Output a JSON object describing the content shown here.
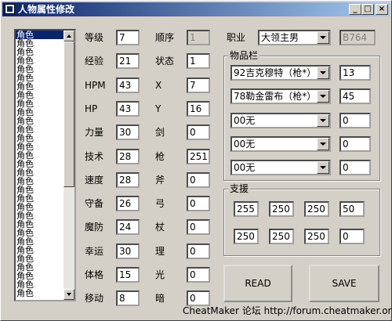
{
  "window": {
    "title": "人物属性修改",
    "minimize": "_",
    "maximize": "□",
    "close": "×"
  },
  "list": {
    "selected_index": 0,
    "items": [
      "角色",
      "角色",
      "角色",
      "角色",
      "角色",
      "角色",
      "角色",
      "角色",
      "角色",
      "角色",
      "角色",
      "角色",
      "角色",
      "角色",
      "角色",
      "角色",
      "角色",
      "角色",
      "角色",
      "角色",
      "角色",
      "角色",
      "角色",
      "角色",
      "角色",
      "角色",
      "角色",
      "角色",
      "角色",
      "角色",
      "角色"
    ]
  },
  "stats_left": [
    {
      "label": "等级",
      "value": "7"
    },
    {
      "label": "经验",
      "value": "21"
    },
    {
      "label": "HPM",
      "value": "43"
    },
    {
      "label": "HP",
      "value": "43"
    },
    {
      "label": "力量",
      "value": "30"
    },
    {
      "label": "技术",
      "value": "28"
    },
    {
      "label": "速度",
      "value": "28"
    },
    {
      "label": "守备",
      "value": "26"
    },
    {
      "label": "魔防",
      "value": "24"
    },
    {
      "label": "幸运",
      "value": "30"
    },
    {
      "label": "体格",
      "value": "15"
    },
    {
      "label": "移动",
      "value": "8"
    }
  ],
  "stats_right": [
    {
      "label": "顺序",
      "value": "1",
      "disabled": true
    },
    {
      "label": "状态",
      "value": "1"
    },
    {
      "label": "X",
      "value": "7"
    },
    {
      "label": "Y",
      "value": "16"
    },
    {
      "label": "剑",
      "value": "0"
    },
    {
      "label": "枪",
      "value": "251"
    },
    {
      "label": "斧",
      "value": "0"
    },
    {
      "label": "弓",
      "value": "0"
    },
    {
      "label": "杖",
      "value": "0"
    },
    {
      "label": "理",
      "value": "0"
    },
    {
      "label": "光",
      "value": "0"
    },
    {
      "label": "暗",
      "value": "0"
    }
  ],
  "profession": {
    "label": "职业",
    "value": "大领主男",
    "code": "B764"
  },
  "items_group": {
    "title": "物品栏",
    "items": [
      {
        "name": "92吉克穆特（枪*）",
        "count": "13"
      },
      {
        "name": "78勒金雷布（枪*）",
        "count": "45"
      },
      {
        "name": "00无",
        "count": "0"
      },
      {
        "name": "00无",
        "count": "0"
      },
      {
        "name": "00无",
        "count": "0"
      }
    ]
  },
  "support_group": {
    "title": "支援",
    "row1": [
      "255",
      "250",
      "250",
      "50"
    ],
    "row2": [
      "250",
      "250",
      "250",
      "0"
    ]
  },
  "buttons": {
    "read": "READ",
    "save": "SAVE"
  },
  "footer": "CheatMaker 论坛 http://forum.cheatmaker.org/"
}
